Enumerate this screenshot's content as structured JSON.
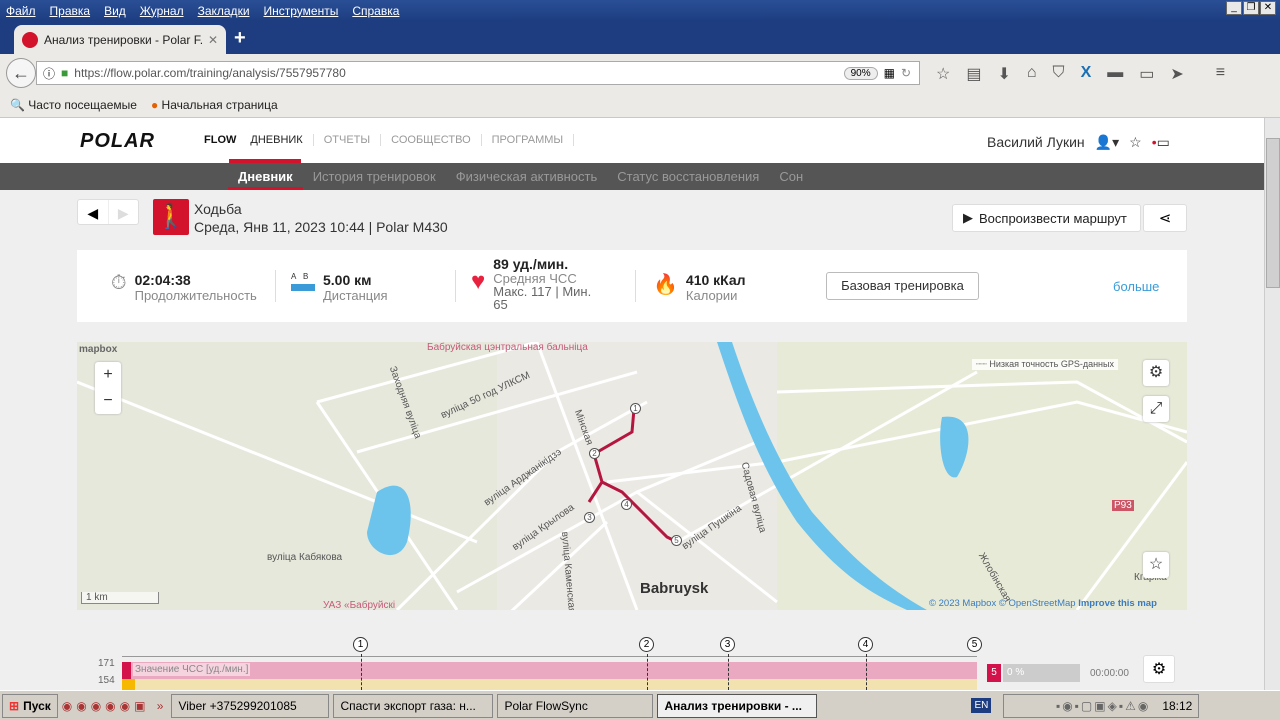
{
  "browser": {
    "menu": [
      "Файл",
      "Правка",
      "Вид",
      "Журнал",
      "Закладки",
      "Инструменты",
      "Справка"
    ],
    "tab_title": "Анализ тренировки - Polar F...",
    "url": "https://flow.polar.com/training/analysis/7557957780",
    "zoom": "90%",
    "bookmarks": [
      "Часто посещаемые",
      "Начальная страница"
    ]
  },
  "header": {
    "brand": "POLAR",
    "product": "FLOW",
    "nav": [
      "ДНЕВНИК",
      "ОТЧЕТЫ",
      "СООБЩЕСТВО",
      "ПРОГРАММЫ"
    ],
    "user": "Василий Лукин",
    "subnav": [
      "Дневник",
      "История тренировок",
      "Физическая активность",
      "Статус восстановления",
      "Сон"
    ]
  },
  "activity": {
    "sport": "Ходьба",
    "date": "Среда, Янв 11, 2023 10:44",
    "device": "Polar M430",
    "sep": "|",
    "replay": "Воспроизвести маршрут"
  },
  "stats": {
    "duration": {
      "value": "02:04:38",
      "label": "Продолжительность"
    },
    "distance": {
      "value": "5.00 км",
      "label": "Дистанция",
      "a": "A",
      "b": "B"
    },
    "hr": {
      "value": "89 уд./мин.",
      "label": "Средняя ЧСС",
      "minmax": "Макс. 117  |  Мин. 65"
    },
    "calories": {
      "value": "410 кКал",
      "label": "Калории"
    },
    "base_button": "Базовая тренировка",
    "more": "больше"
  },
  "map": {
    "labels": [
      "Бабруйская цэнтральная бальніца",
      "вуліца 50 год УЛКСМ",
      "Заходняя вуліца",
      "Мінская",
      "вуліца Арджанікідзэ",
      "вуліца Крылова",
      "вуліца Кабякова",
      "УАЗ «Бабруйскі",
      "Садовая вуліца",
      "вуліца Пушкіна",
      "Babruysk",
      "Жлобінская",
      "Кгаріка",
      "Р93",
      "вуліца Каменская"
    ],
    "laps": [
      "1",
      "2",
      "3",
      "4",
      "5"
    ],
    "scale": "1 km",
    "gps_legend": "Низкая точность GPS-данных",
    "attribution": {
      "copy": "© 2023 Mapbox",
      "osm": "© OpenStreetMap",
      "improve": "Improve this map"
    },
    "mapbox": "mapbox",
    "route_color": "#b5163f"
  },
  "chart": {
    "y_ticks": [
      "171",
      "154"
    ],
    "series_label": "Значение ЧСС [уд./мин.]",
    "laps": [
      "1",
      "2",
      "3",
      "4",
      "5"
    ],
    "zone": "5",
    "zone_pct": "0 %",
    "zone_time": "00:00:00"
  },
  "taskbar": {
    "start": "Пуск",
    "items": [
      "Viber +375299201085",
      "Спасти экспорт газа: н...",
      "Polar FlowSync",
      "Анализ тренировки - ..."
    ],
    "lang": "EN",
    "clock": "18:12"
  }
}
